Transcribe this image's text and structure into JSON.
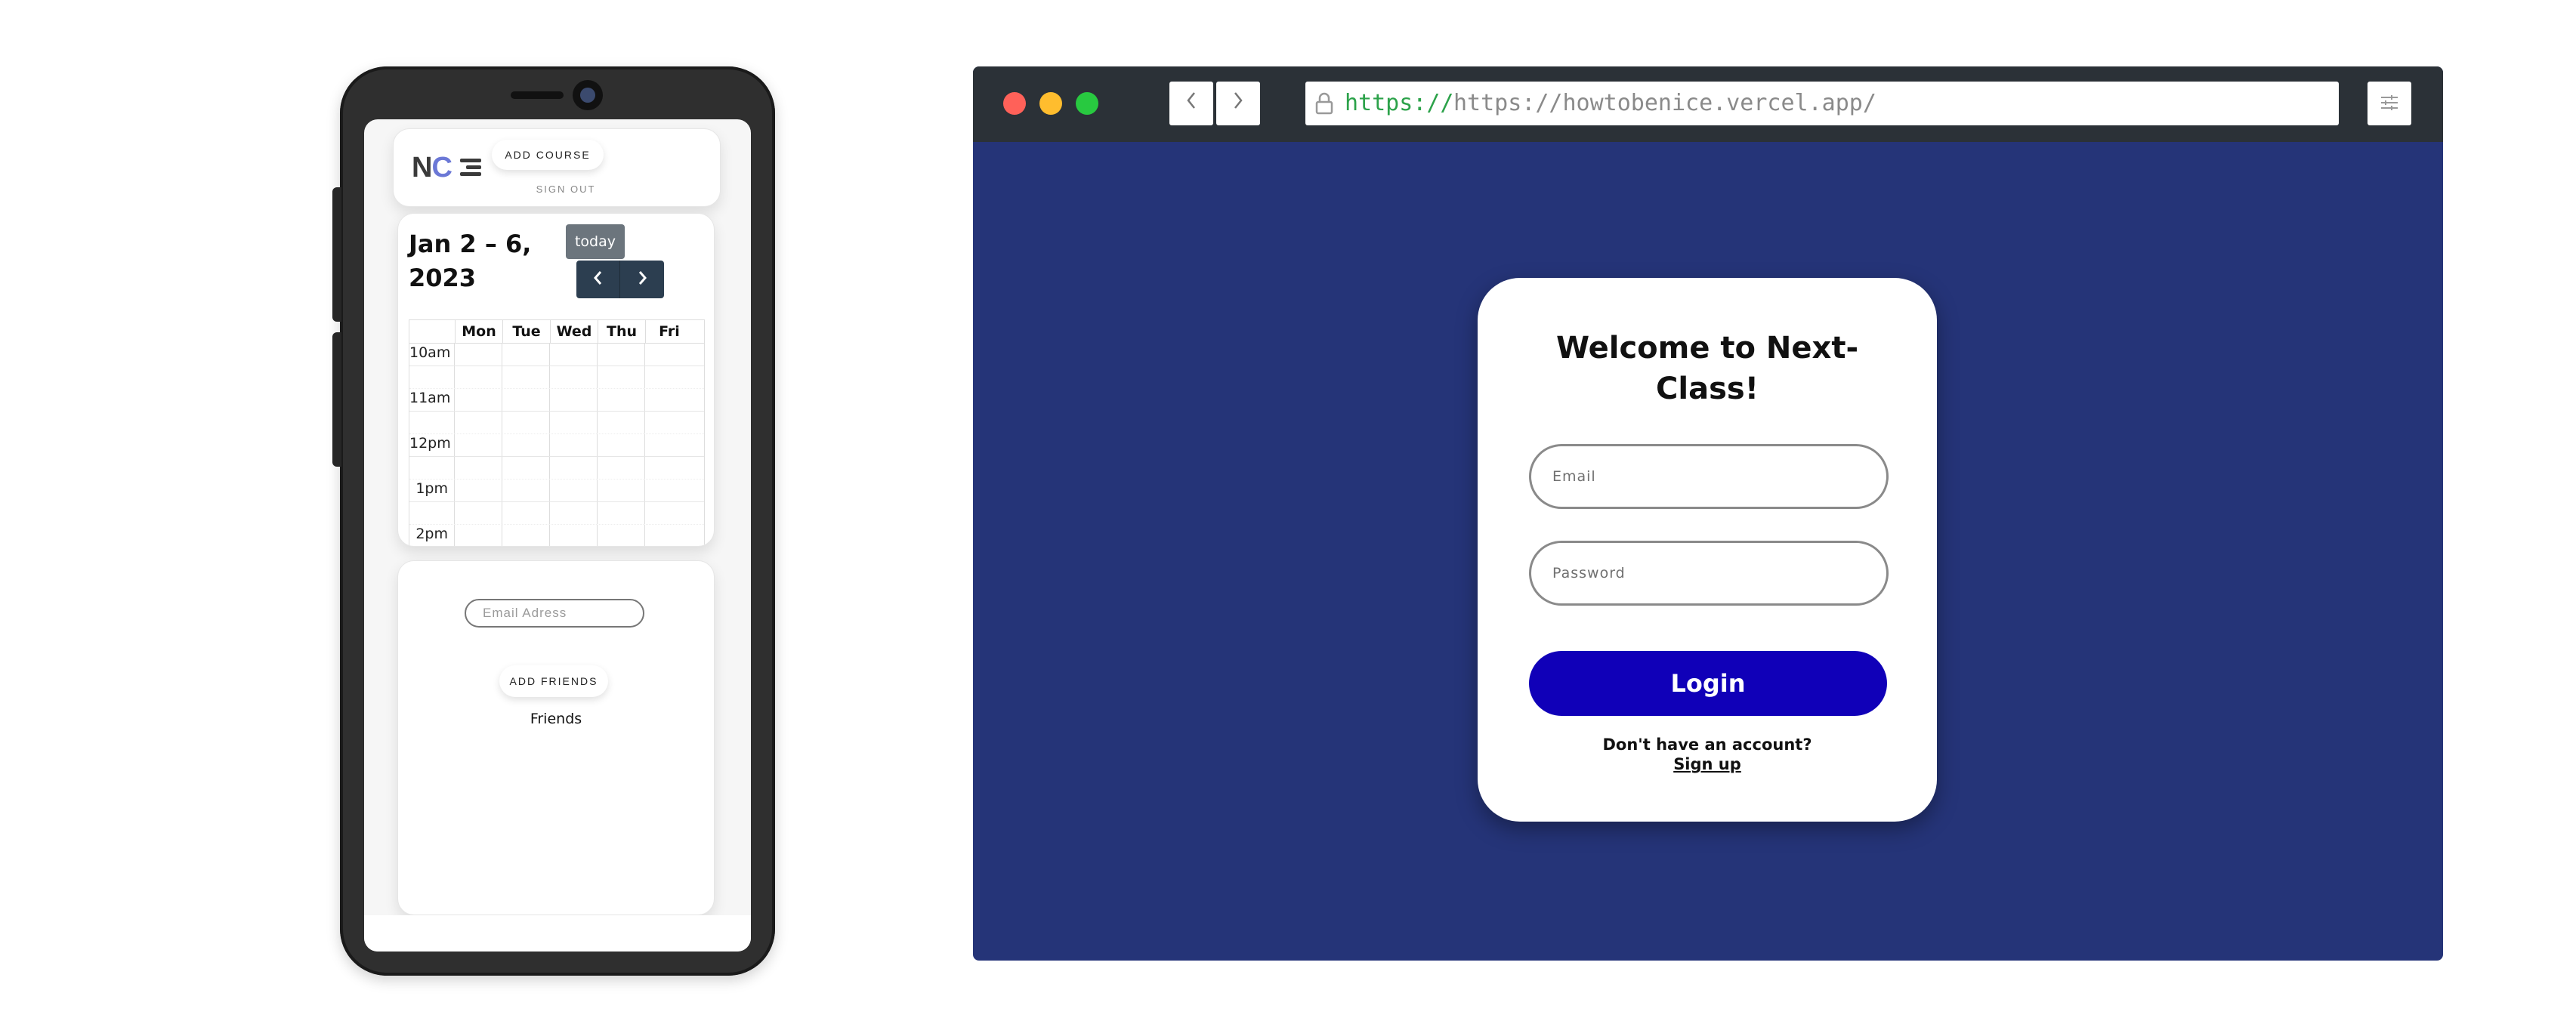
{
  "colors": {
    "browser_background": "#253478",
    "titlebar": "#2b3137",
    "login_button": "#1000b8",
    "calendar_nav_button": "#2c3e50",
    "today_button": "#6c757d",
    "url_scheme": "#2ca24a"
  },
  "phone": {
    "nav": {
      "logo_text_n": "N",
      "logo_text_c": "C",
      "add_course_label": "ADD COURSE",
      "sign_out_label": "SIGN OUT"
    },
    "calendar": {
      "title": "Jan 2 – 6, 2023",
      "today_label": "today",
      "prev_icon": "chevron-left-icon",
      "next_icon": "chevron-right-icon",
      "days": [
        "Mon",
        "Tue",
        "Wed",
        "Thu",
        "Fri"
      ],
      "times": [
        "10am",
        "11am",
        "12pm",
        "1pm",
        "2pm"
      ]
    },
    "friends": {
      "email_placeholder": "Email Adress",
      "add_friends_label": "ADD FRIENDS",
      "friends_label": "Friends"
    }
  },
  "browser": {
    "url_scheme": "https://",
    "url_rest": "https://howtobenice.vercel.app/",
    "back_icon": "chevron-left-icon",
    "forward_icon": "chevron-right-icon",
    "lock_icon": "lock-icon",
    "menu_icon": "sliders-icon"
  },
  "login": {
    "title": "Welcome to Next-Class!",
    "email_placeholder": "Email",
    "password_placeholder": "Password",
    "login_label": "Login",
    "no_account_text": "Don't have an account?",
    "signup_label": "Sign up"
  }
}
